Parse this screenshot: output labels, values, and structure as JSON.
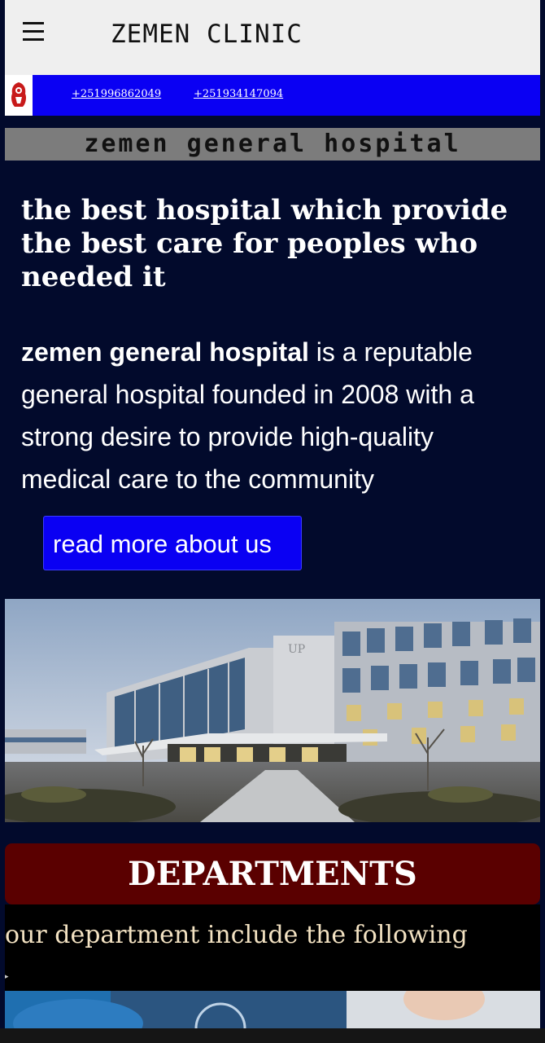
{
  "header": {
    "title": "ZEMEN CLINIC",
    "menu_icon": "hamburger-menu-icon"
  },
  "contact": {
    "logo_icon": "clinic-logo-icon",
    "phone_1": "+251996862049",
    "phone_2": "+251934147094"
  },
  "banner": {
    "text": "zemen general hospital"
  },
  "hero": {
    "headline": "the best hospital which provide the best care for peoples who needed it",
    "intro_bold": "zemen general hospital",
    "intro_rest": " is a reputable general hospital founded in 2008 with a strong desire to provide high-quality medical care to the community",
    "cta_label": "read more about us"
  },
  "departments": {
    "title": "DEPARTMENTS",
    "subtitle": "our department include the following",
    "marker": "▸"
  },
  "colors": {
    "page_bg": "#020a2c",
    "contact_bar": "#0a00f3",
    "departments_header": "#5a0000",
    "subtitle_text": "#f3e2c2"
  }
}
